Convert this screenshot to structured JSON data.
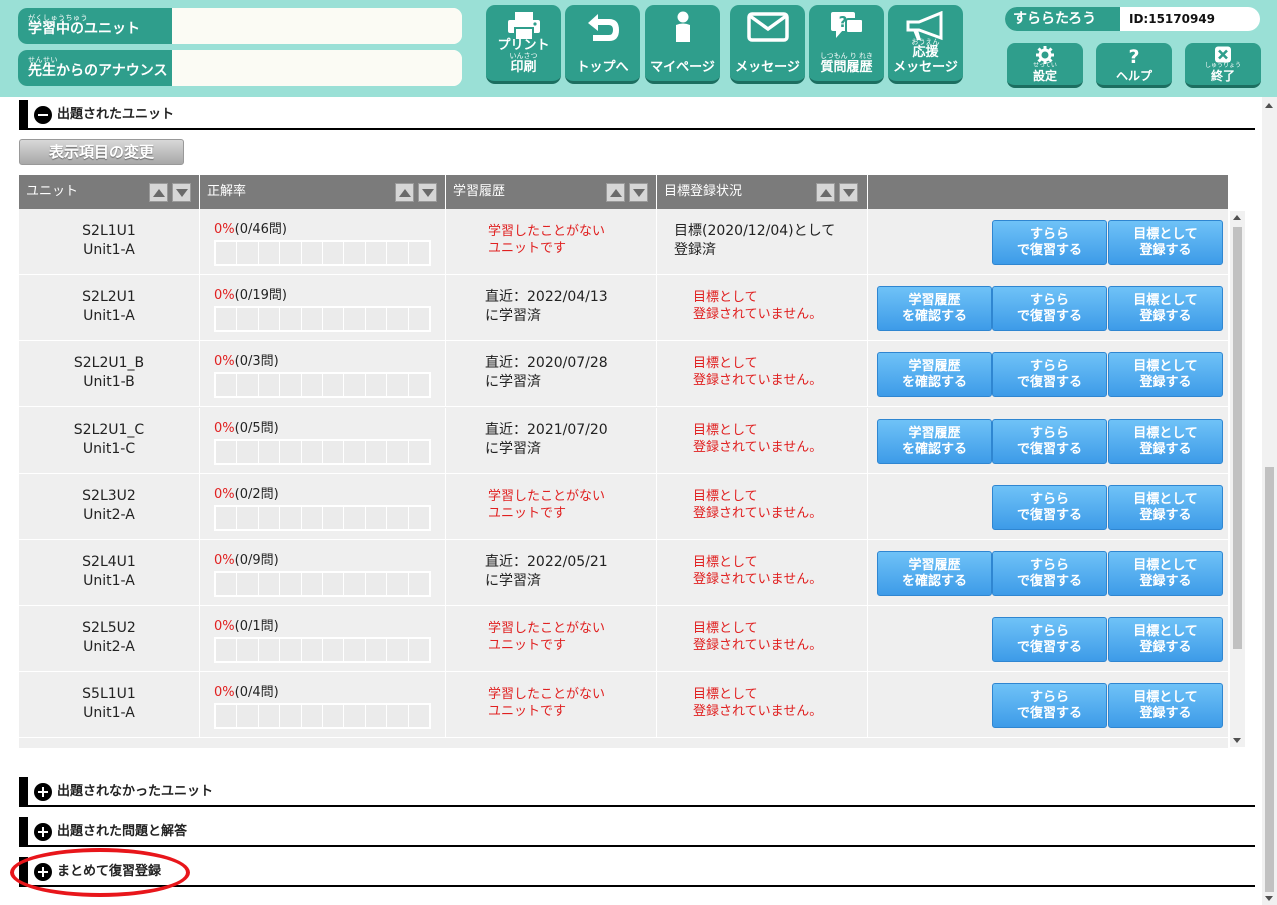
{
  "header": {
    "current_unit": {
      "ruby": "がくしゅうちゅう",
      "label": "学習中のユニット",
      "value": ""
    },
    "announce": {
      "ruby": "せんせい",
      "label": "先生からのアナウンス",
      "value": ""
    },
    "nav": {
      "print": {
        "label": "プリント",
        "ruby": "いんさつ",
        "sub": "印刷",
        "icon": "printer-icon"
      },
      "top": {
        "label": "トップへ",
        "icon": "return-arrow-icon"
      },
      "mypage": {
        "label": "マイページ",
        "icon": "person-icon"
      },
      "message": {
        "label": "メッセージ",
        "icon": "envelope-icon"
      },
      "qhistory": {
        "ruby": "しつもん り れき",
        "label": "質問履歴",
        "icon": "question-bubble-icon"
      },
      "cheer": {
        "ruby": "おうえん",
        "label": "応援",
        "sub": "メッセージ",
        "icon": "megaphone-icon"
      }
    },
    "user": {
      "name": "すららたろう",
      "id": "ID:15170949"
    },
    "settings": {
      "ruby": "せってい",
      "label": "設定",
      "icon": "gear-icon"
    },
    "help": {
      "label": "ヘルプ",
      "icon": "question-mark-icon"
    },
    "exit": {
      "ruby": "しゅうりょう",
      "label": "終了",
      "icon": "close-box-icon"
    }
  },
  "sections": {
    "assigned": "出題されたユニット",
    "not_assigned": "出題されなかったユニット",
    "problems": "出題された問題と解答",
    "bulk_review": "まとめて復習登録"
  },
  "change_display_button": "表示項目の変更",
  "table": {
    "columns": [
      "ユニット",
      "正解率",
      "学習履歴",
      "目標登録状況"
    ],
    "rows": [
      {
        "code": "S2L1U1",
        "name": "Unit1-A",
        "pct": "0%",
        "count": "(0/46問)",
        "hist1": "学習したことがない",
        "hist2": "ユニットです",
        "hist_red": true,
        "goal1": "目標(2020/12/04)として",
        "goal2": "登録済",
        "goal_red": false,
        "has_history_btn": false
      },
      {
        "code": "S2L2U1",
        "name": "Unit1-A",
        "pct": "0%",
        "count": "(0/19問)",
        "hist1": "直近：2022/04/13",
        "hist2": "に学習済",
        "hist_red": false,
        "goal1": "目標として",
        "goal2": "登録されていません。",
        "goal_red": true,
        "has_history_btn": true
      },
      {
        "code": "S2L2U1_B",
        "name": "Unit1-B",
        "pct": "0%",
        "count": "(0/3問)",
        "hist1": "直近：2020/07/28",
        "hist2": "に学習済",
        "hist_red": false,
        "goal1": "目標として",
        "goal2": "登録されていません。",
        "goal_red": true,
        "has_history_btn": true
      },
      {
        "code": "S2L2U1_C",
        "name": "Unit1-C",
        "pct": "0%",
        "count": "(0/5問)",
        "hist1": "直近：2021/07/20",
        "hist2": "に学習済",
        "hist_red": false,
        "goal1": "目標として",
        "goal2": "登録されていません。",
        "goal_red": true,
        "has_history_btn": true
      },
      {
        "code": "S2L3U2",
        "name": "Unit2-A",
        "pct": "0%",
        "count": "(0/2問)",
        "hist1": "学習したことがない",
        "hist2": "ユニットです",
        "hist_red": true,
        "goal1": "目標として",
        "goal2": "登録されていません。",
        "goal_red": true,
        "has_history_btn": false
      },
      {
        "code": "S2L4U1",
        "name": "Unit1-A",
        "pct": "0%",
        "count": "(0/9問)",
        "hist1": "直近：2022/05/21",
        "hist2": "に学習済",
        "hist_red": false,
        "goal1": "目標として",
        "goal2": "登録されていません。",
        "goal_red": true,
        "has_history_btn": true
      },
      {
        "code": "S2L5U2",
        "name": "Unit2-A",
        "pct": "0%",
        "count": "(0/1問)",
        "hist1": "学習したことがない",
        "hist2": "ユニットです",
        "hist_red": true,
        "goal1": "目標として",
        "goal2": "登録されていません。",
        "goal_red": true,
        "has_history_btn": false
      },
      {
        "code": "S5L1U1",
        "name": "Unit1-A",
        "pct": "0%",
        "count": "(0/4問)",
        "hist1": "学習したことがない",
        "hist2": "ユニットです",
        "hist_red": true,
        "goal1": "目標として",
        "goal2": "登録されていません。",
        "goal_red": true,
        "has_history_btn": false
      }
    ],
    "buttons": {
      "history": [
        "学習履歴",
        "を確認する"
      ],
      "review": [
        "すらら",
        "で復習する"
      ],
      "goal": [
        "目標として",
        "登録する"
      ]
    }
  },
  "colors": {
    "header_bg": "#9ae0d6",
    "teal": "#2f9e8c",
    "button_blue": "#3d9be8",
    "alert_red": "#e02020",
    "table_header": "#7b7b7b",
    "highlight_ring": "#e8161b"
  }
}
